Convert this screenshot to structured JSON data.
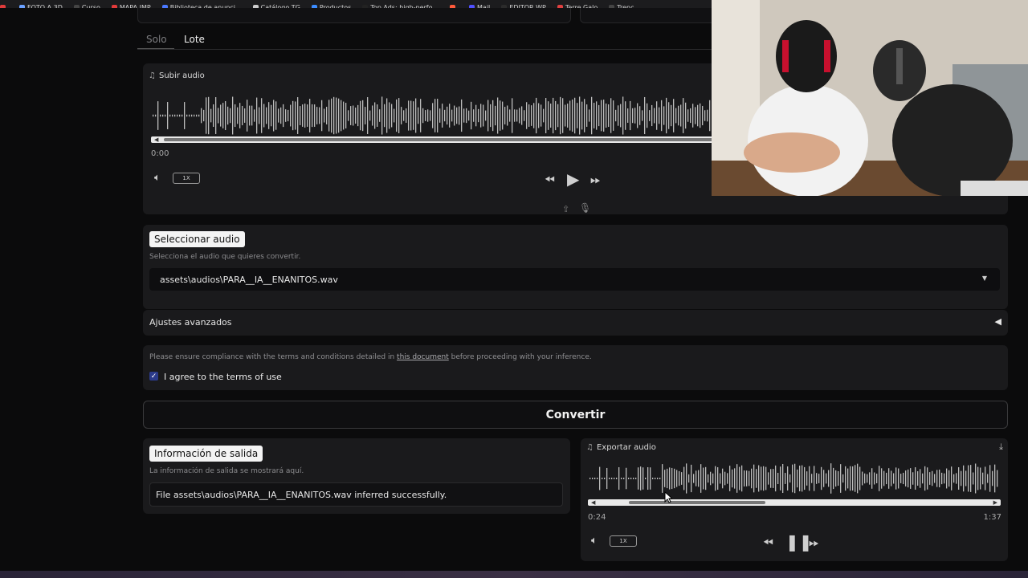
{
  "bookmarks": [
    {
      "label": "",
      "color": "#e03b3b"
    },
    {
      "label": "FOTO A 3D",
      "color": "#6aa0ff"
    },
    {
      "label": "Curso",
      "color": "#444"
    },
    {
      "label": "MAPA IMP",
      "color": "#e23a3a"
    },
    {
      "label": "Biblioteca de anunci...",
      "color": "#4a78ff"
    },
    {
      "label": "Catálogo TG",
      "color": "#cccccc"
    },
    {
      "label": "Productos",
      "color": "#3b8cff"
    },
    {
      "label": "Top Ads: high-perfo...",
      "color": "#222"
    },
    {
      "label": "",
      "color": "#ff5a3b"
    },
    {
      "label": "Mail",
      "color": "#5050ff"
    },
    {
      "label": "EDITOR WP",
      "color": "#2b2b2b"
    },
    {
      "label": "Terre Galo",
      "color": "#e04040"
    },
    {
      "label": "Trenc",
      "color": "#444"
    }
  ],
  "tabs": {
    "solo": "Solo",
    "lote": "Lote"
  },
  "upload": {
    "label": "Subir audio",
    "time_current": "0:00",
    "speed": "1X"
  },
  "select_audio": {
    "label": "Seleccionar audio",
    "hint": "Selecciona el audio que quieres convertir.",
    "value": "assets\\audios\\PARA__IA__ENANITOS.wav"
  },
  "advanced": {
    "label": "Ajustes avanzados"
  },
  "terms": {
    "text_before": "Please ensure compliance with the terms and conditions detailed in ",
    "link": "this document",
    "text_after": " before proceeding with your inference.",
    "checkbox_label": "I agree to the terms of use",
    "checked": true
  },
  "convert_button": "Convertir",
  "output_info": {
    "label": "Información de salida",
    "hint": "La información de salida se mostrará aquí.",
    "value": "File assets\\audios\\PARA__IA__ENANITOS.wav inferred successfully."
  },
  "export": {
    "label": "Exportar audio",
    "time_current": "0:24",
    "time_total": "1:37",
    "speed": "1X",
    "scroll_fraction_start": 0.1,
    "scroll_fraction_end": 0.43
  },
  "colors": {
    "accent": "#2b3a8a",
    "panel": "#1a1a1c",
    "wave": "#bdbdbd"
  }
}
